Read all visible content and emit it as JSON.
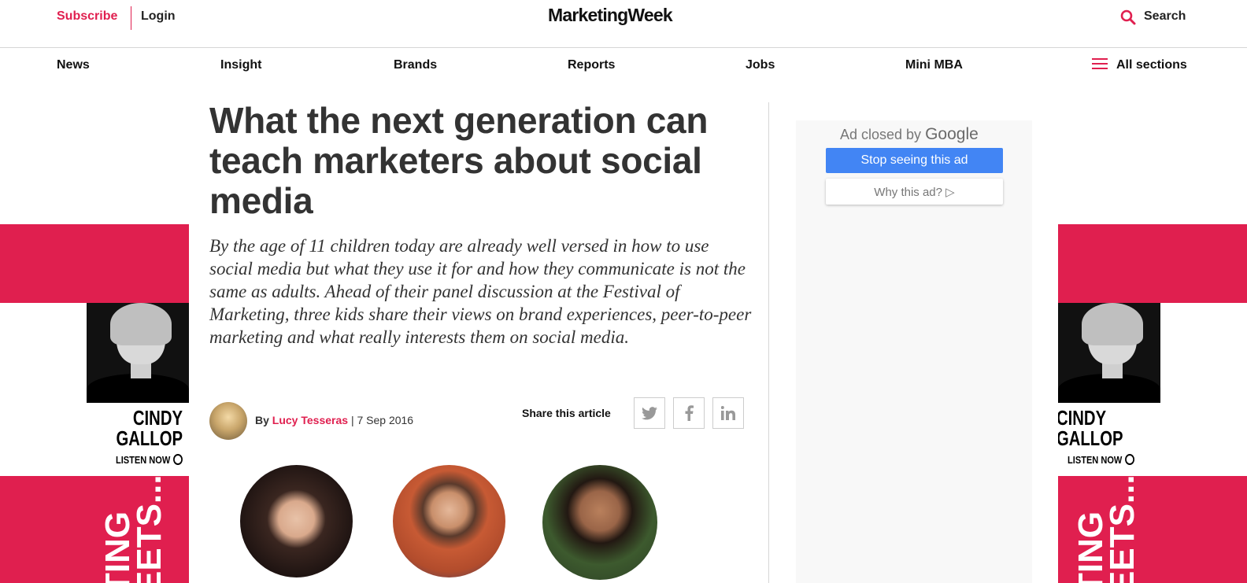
{
  "header": {
    "subscribe_label": "Subscribe",
    "login_label": "Login",
    "logo_text": "MarketingWeek",
    "search_label": "Search"
  },
  "nav": {
    "items": [
      "News",
      "Insight",
      "Brands",
      "Reports",
      "Jobs",
      "Mini MBA"
    ],
    "all_sections_label": "All sections"
  },
  "side_ad": {
    "name_line1": "CINDY",
    "name_line2": "GALLOP",
    "listen_label": "LISTEN NOW",
    "vertical_text_line1": "TING",
    "vertical_text_line2": "EETS..."
  },
  "article": {
    "headline": "What the next generation can teach marketers about social media",
    "standfirst": "By the age of 11 children today are already well versed in how to use social media but what they use it for and how they communicate is not the same as adults. Ahead of their panel discussion at the Festival of Marketing, three kids share their views on brand experiences, peer-to-peer marketing and what really interests them on social media.",
    "by_label": "By",
    "author": "Lucy Tesseras",
    "date": "| 7 Sep 2016",
    "share_label": "Share this article"
  },
  "ad": {
    "closed_by": "Ad closed by",
    "google": "Google",
    "stop_label": "Stop seeing this ad",
    "why_label": "Why this ad? ▷"
  },
  "colors": {
    "accent": "#e01f4f",
    "ad_button": "#4285f4"
  }
}
